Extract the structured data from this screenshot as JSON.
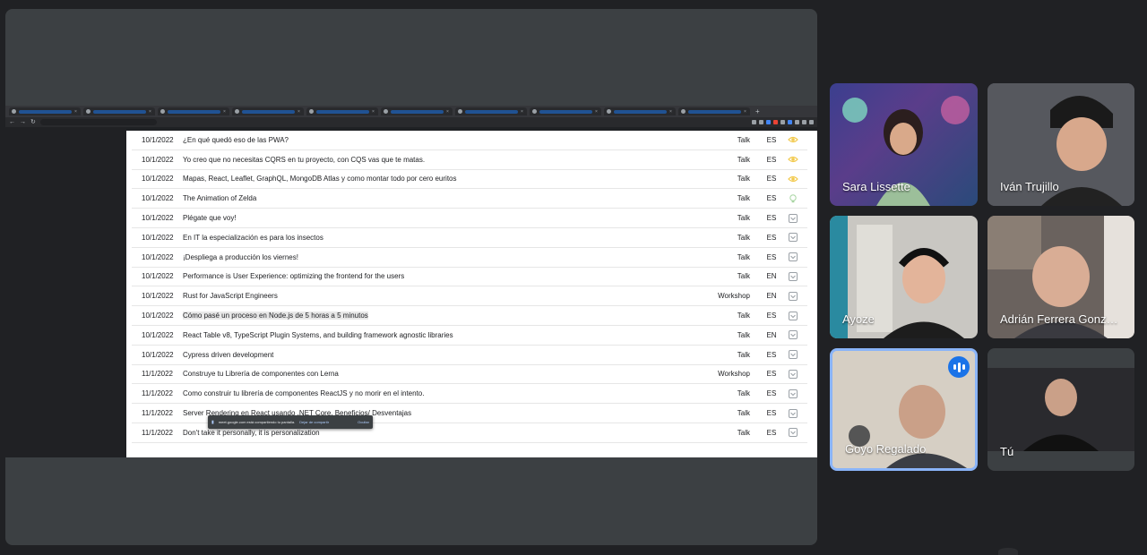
{
  "participants": [
    {
      "name": "Sara Lissette",
      "speaking": false
    },
    {
      "name": "Iván Trujillo",
      "speaking": false
    },
    {
      "name": "Ayoze",
      "speaking": false
    },
    {
      "name": "Adrián Ferrera Gonz…",
      "speaking": false
    },
    {
      "name": "Goyo Regalado",
      "speaking": true
    },
    {
      "name": "Tú",
      "speaking": false
    }
  ],
  "shared_screen": {
    "talks": [
      {
        "date": "10/1/2022",
        "title": "¿En qué quedó eso de las PWA?",
        "type": "Talk",
        "lang": "ES",
        "status_icon": "eye-icon"
      },
      {
        "date": "10/1/2022",
        "title": "Yo creo que no necesitas CQRS en tu proyecto, con CQS vas que te matas.",
        "type": "Talk",
        "lang": "ES",
        "status_icon": "eye-icon"
      },
      {
        "date": "10/1/2022",
        "title": "Mapas, React, Leaflet, GraphQL, MongoDB Atlas y como montar todo por cero euritos",
        "type": "Talk",
        "lang": "ES",
        "status_icon": "eye-icon"
      },
      {
        "date": "10/1/2022",
        "title": "The Animation of Zelda",
        "type": "Talk",
        "lang": "ES",
        "status_icon": "lightbulb-icon"
      },
      {
        "date": "10/1/2022",
        "title": "Plégate que voy!",
        "type": "Talk",
        "lang": "ES",
        "status_icon": "inbox-icon"
      },
      {
        "date": "10/1/2022",
        "title": "En IT la especialización es para los insectos",
        "type": "Talk",
        "lang": "ES",
        "status_icon": "inbox-icon"
      },
      {
        "date": "10/1/2022",
        "title": "¡Despliega a producción los viernes!",
        "type": "Talk",
        "lang": "ES",
        "status_icon": "inbox-icon"
      },
      {
        "date": "10/1/2022",
        "title": "Performance is User Experience: optimizing the frontend for the users",
        "type": "Talk",
        "lang": "EN",
        "status_icon": "inbox-icon"
      },
      {
        "date": "10/1/2022",
        "title": "Rust for JavaScript Engineers",
        "type": "Workshop",
        "lang": "EN",
        "status_icon": "inbox-icon"
      },
      {
        "date": "10/1/2022",
        "title": "Cómo pasé un proceso en Node.js de 5 horas a 5 minutos",
        "type": "Talk",
        "lang": "ES",
        "status_icon": "inbox-icon"
      },
      {
        "date": "10/1/2022",
        "title": "React Table v8, TypeScript Plugin Systems, and building framework agnostic libraries",
        "type": "Talk",
        "lang": "EN",
        "status_icon": "inbox-icon"
      },
      {
        "date": "10/1/2022",
        "title": "Cypress driven development",
        "type": "Talk",
        "lang": "ES",
        "status_icon": "inbox-icon"
      },
      {
        "date": "11/1/2022",
        "title": "Construye tu Librería de componentes con Lerna",
        "type": "Workshop",
        "lang": "ES",
        "status_icon": "inbox-icon"
      },
      {
        "date": "11/1/2022",
        "title": "Como construir tu librería de componentes ReactJS y no morir en el intento.",
        "type": "Talk",
        "lang": "ES",
        "status_icon": "inbox-icon"
      },
      {
        "date": "11/1/2022",
        "title": "Server Rendering en React usando .NET Core. Beneficios/ Desventajas",
        "type": "Talk",
        "lang": "ES",
        "status_icon": "inbox-icon"
      },
      {
        "date": "11/1/2022",
        "title": "Don't take it personally, it is personalization",
        "type": "Talk",
        "lang": "ES",
        "status_icon": "inbox-icon"
      }
    ],
    "highlighted_row": 9,
    "share_notice": {
      "text": "meet.google.com está compartiendo tu pantalla.",
      "stop_label": "Dejar de compartir",
      "hide_label": "Ocultar"
    }
  },
  "colors": {
    "background": "#202124",
    "tile": "#3c4043",
    "speaking_border": "#8ab4f8",
    "eye_icon": "#f2c94c",
    "lightbulb_icon": "#a8d5a2",
    "inbox_icon": "#9aa0a6"
  }
}
